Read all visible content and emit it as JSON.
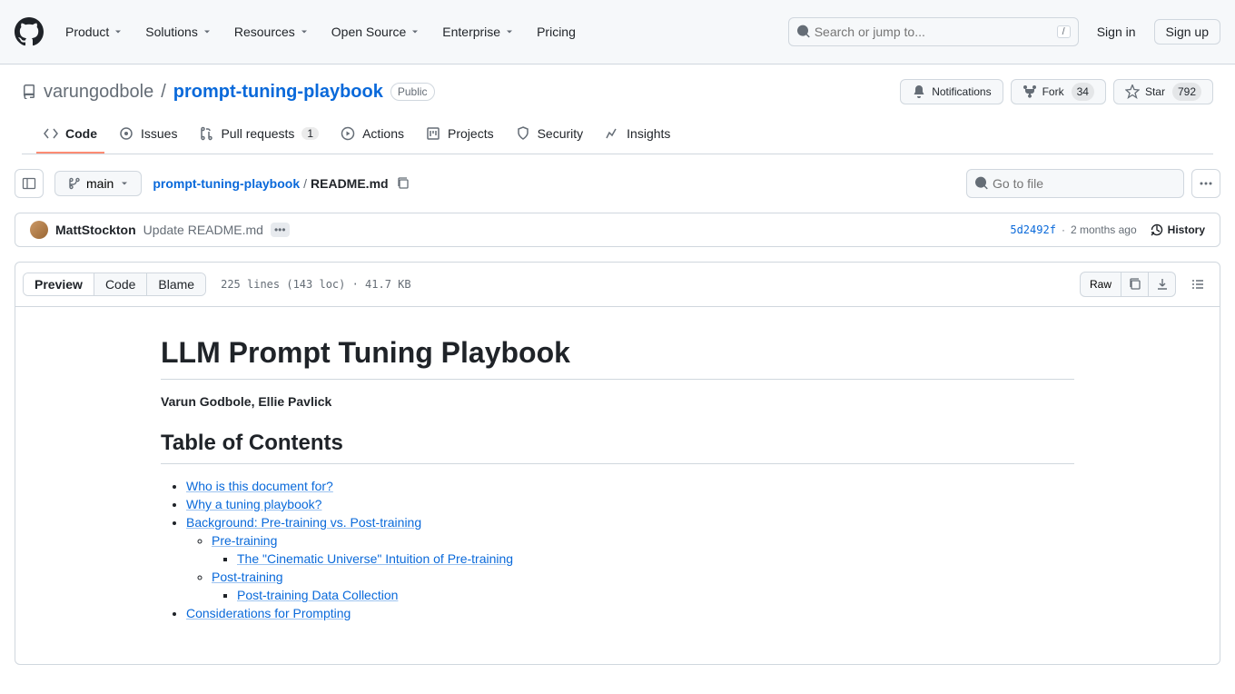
{
  "header": {
    "nav": [
      "Product",
      "Solutions",
      "Resources",
      "Open Source",
      "Enterprise",
      "Pricing"
    ],
    "search_placeholder": "Search or jump to...",
    "search_kbd": "/",
    "signin": "Sign in",
    "signup": "Sign up"
  },
  "repo": {
    "owner": "varungodbole",
    "name": "prompt-tuning-playbook",
    "visibility": "Public",
    "actions": {
      "notifications": "Notifications",
      "fork": "Fork",
      "fork_count": "34",
      "star": "Star",
      "star_count": "792"
    }
  },
  "tabs": {
    "code": "Code",
    "issues": "Issues",
    "pulls": "Pull requests",
    "pulls_count": "1",
    "actions": "Actions",
    "projects": "Projects",
    "security": "Security",
    "insights": "Insights"
  },
  "file_nav": {
    "branch": "main",
    "crumb_repo": "prompt-tuning-playbook",
    "crumb_file": "README.md",
    "go_to_file": "Go to file"
  },
  "commit": {
    "author": "MattStockton",
    "message": "Update README.md",
    "sha": "5d2492f",
    "rel_time": "2 months ago",
    "history": "History"
  },
  "file_toolbar": {
    "preview": "Preview",
    "code": "Code",
    "blame": "Blame",
    "info": "225 lines (143 loc) · 41.7 KB",
    "raw": "Raw"
  },
  "md": {
    "h1": "LLM Prompt Tuning Playbook",
    "authors": "Varun Godbole, Ellie Pavlick",
    "toc_heading": "Table of Contents",
    "toc": {
      "who": "Who is this document for?",
      "why": "Why a tuning playbook?",
      "bg": "Background: Pre-training vs. Post-training",
      "pre": "Pre-training",
      "cinematic": "The \"Cinematic Universe\" Intuition of Pre-training",
      "post": "Post-training",
      "postdata": "Post-training Data Collection",
      "consider": "Considerations for Prompting"
    }
  }
}
